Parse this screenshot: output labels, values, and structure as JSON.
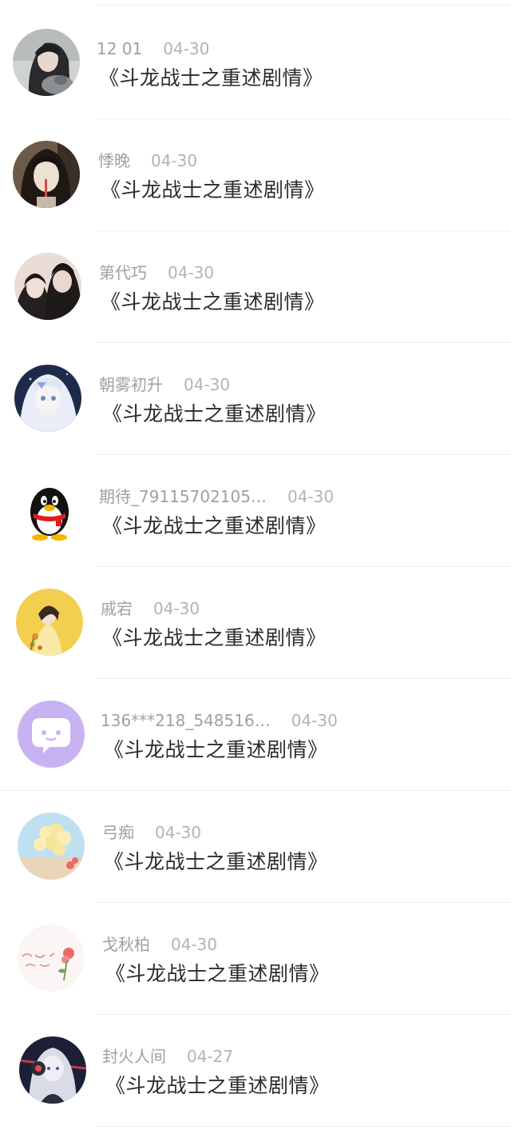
{
  "comments": [
    {
      "user": "12 01",
      "date": "04-30",
      "text": "《斗龙战士之重述剧情》",
      "avatar": "dark-hair-girl-with-cat"
    },
    {
      "user": "悸晚",
      "date": "04-30",
      "text": "《斗龙战士之重述剧情》",
      "avatar": "girl-with-straw"
    },
    {
      "user": "第代巧",
      "date": "04-30",
      "text": "《斗龙战士之重述剧情》",
      "avatar": "couple-selfie"
    },
    {
      "user": "朝雾初升",
      "date": "04-30",
      "text": "《斗龙战士之重述剧情》",
      "avatar": "anime-white-hair"
    },
    {
      "user": "期待_79115702105…",
      "date": "04-30",
      "text": "《斗龙战士之重述剧情》",
      "avatar": "qq-penguin"
    },
    {
      "user": "戚宕",
      "date": "04-30",
      "text": "《斗龙战士之重述剧情》",
      "avatar": "yellow-illustration"
    },
    {
      "user": "136***218_548516…",
      "date": "04-30",
      "text": "《斗龙战士之重述剧情》",
      "avatar": "purple-chat-bubble"
    },
    {
      "user": "弓痴",
      "date": "04-30",
      "text": "《斗龙战士之重述剧情》",
      "avatar": "balloons"
    },
    {
      "user": "戈秋柏",
      "date": "04-30",
      "text": "《斗龙战士之重述剧情》",
      "avatar": "flower-handwriting"
    },
    {
      "user": "封火人间",
      "date": "04-27",
      "text": "《斗龙战士之重述剧情》",
      "avatar": "anime-headphones"
    }
  ]
}
